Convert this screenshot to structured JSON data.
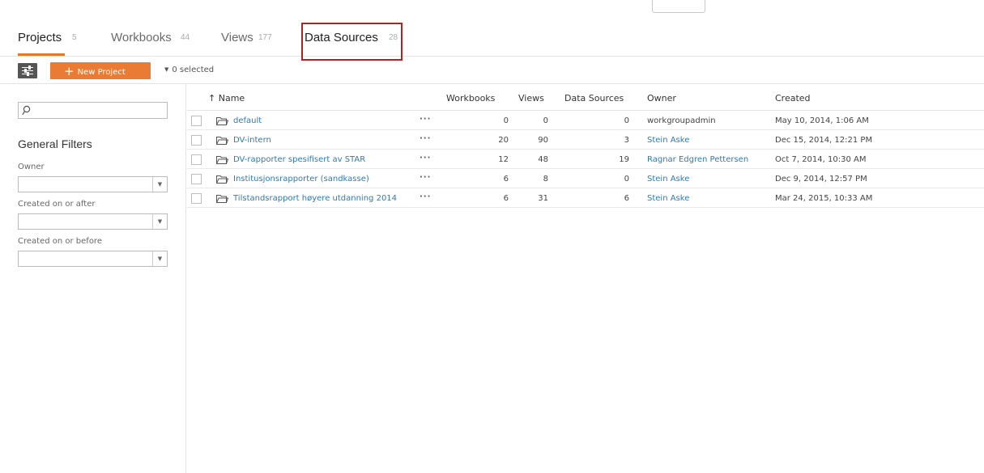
{
  "tabs": [
    {
      "label": "Projects",
      "count": "5"
    },
    {
      "label": "Workbooks",
      "count": "44"
    },
    {
      "label": "Views",
      "count": "177"
    },
    {
      "label": "Data Sources",
      "count": "28"
    }
  ],
  "toolbar": {
    "new_project_label": "New Project",
    "selected_text": "0 selected"
  },
  "sidebar": {
    "search_value": "",
    "general_filters_title": "General Filters",
    "filters": [
      {
        "label": "Owner",
        "value": ""
      },
      {
        "label": "Created on or after",
        "value": ""
      },
      {
        "label": "Created on or before",
        "value": ""
      }
    ]
  },
  "table": {
    "sort_indicator": "↑",
    "columns": {
      "name": "Name",
      "workbooks": "Workbooks",
      "views": "Views",
      "data_sources": "Data Sources",
      "owner": "Owner",
      "created": "Created"
    },
    "row_menu": "···",
    "rows": [
      {
        "name": "default",
        "workbooks": "0",
        "views": "0",
        "data_sources": "0",
        "owner": "workgroupadmin",
        "owner_is_link": false,
        "created": "May 10, 2014, 1:06 AM"
      },
      {
        "name": "DV-intern",
        "workbooks": "20",
        "views": "90",
        "data_sources": "3",
        "owner": "Stein Aske",
        "owner_is_link": true,
        "created": "Dec 15, 2014, 12:21 PM"
      },
      {
        "name": "DV-rapporter spesifisert av STAR",
        "workbooks": "12",
        "views": "48",
        "data_sources": "19",
        "owner": "Ragnar Edgren Pettersen",
        "owner_is_link": true,
        "created": "Oct 7, 2014, 10:30 AM"
      },
      {
        "name": "Institusjonsrapporter (sandkasse)",
        "workbooks": "6",
        "views": "8",
        "data_sources": "0",
        "owner": "Stein Aske",
        "owner_is_link": true,
        "created": "Dec 9, 2014, 12:57 PM"
      },
      {
        "name": "Tilstandsrapport høyere utdanning 2014",
        "workbooks": "6",
        "views": "31",
        "data_sources": "6",
        "owner": "Stein Aske",
        "owner_is_link": true,
        "created": "Mar 24, 2015, 10:33 AM"
      }
    ]
  },
  "colors": {
    "accent": "#e8762b",
    "link": "#2c7ab8",
    "highlight_box": "#b22222"
  },
  "icons": {
    "search": "search-icon",
    "folder": "folder-icon",
    "filter_toggle": "sliders-icon"
  }
}
